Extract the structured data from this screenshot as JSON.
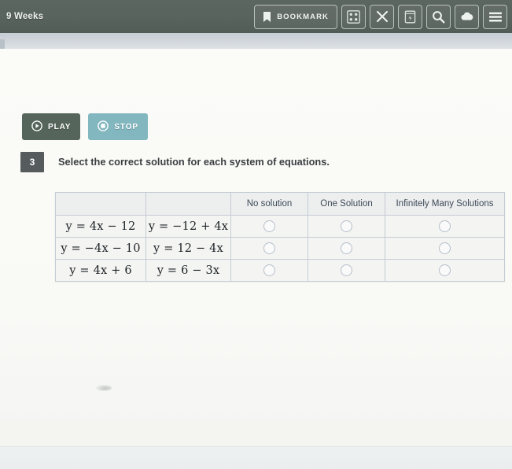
{
  "header": {
    "course_title": "9 Weeks",
    "bookmark_label": "BOOKMARK",
    "tools": [
      {
        "name": "grid-icon",
        "title": "Grid"
      },
      {
        "name": "close-icon",
        "title": "Close"
      },
      {
        "name": "notes-icon",
        "title": "Notes"
      },
      {
        "name": "search-icon",
        "title": "Search"
      },
      {
        "name": "cloud-icon",
        "title": "Cloud"
      },
      {
        "name": "menu-icon",
        "title": "Menu"
      }
    ]
  },
  "media": {
    "play_label": "PLAY",
    "stop_label": "STOP"
  },
  "question": {
    "number": "3",
    "prompt": "Select the correct solution for each system of equations."
  },
  "table": {
    "headers": {
      "equation_1": "",
      "equation_2": "",
      "no_solution": "No solution",
      "one_solution": "One Solution",
      "infinitely_many": "Infinitely Many Solutions"
    },
    "rows": [
      {
        "equation_1": "y = 4x − 12",
        "equation_2": "y = −12 + 4x",
        "no_solution_selected": false,
        "one_solution_selected": false,
        "infinitely_many_selected": false
      },
      {
        "equation_1": "y = −4x − 10",
        "equation_2": "y = 12 − 4x",
        "no_solution_selected": false,
        "one_solution_selected": false,
        "infinitely_many_selected": false
      },
      {
        "equation_1": "y = 4x + 6",
        "equation_2": "y = 6 − 3x",
        "no_solution_selected": false,
        "one_solution_selected": false,
        "infinitely_many_selected": false
      }
    ]
  },
  "colors": {
    "header_bar": "#59635d",
    "play_button": "#55655c",
    "stop_button": "#83b7bf",
    "question_badge": "#565c5e",
    "table_border": "#c4ccd4",
    "page_background": "#fbfbf8"
  }
}
